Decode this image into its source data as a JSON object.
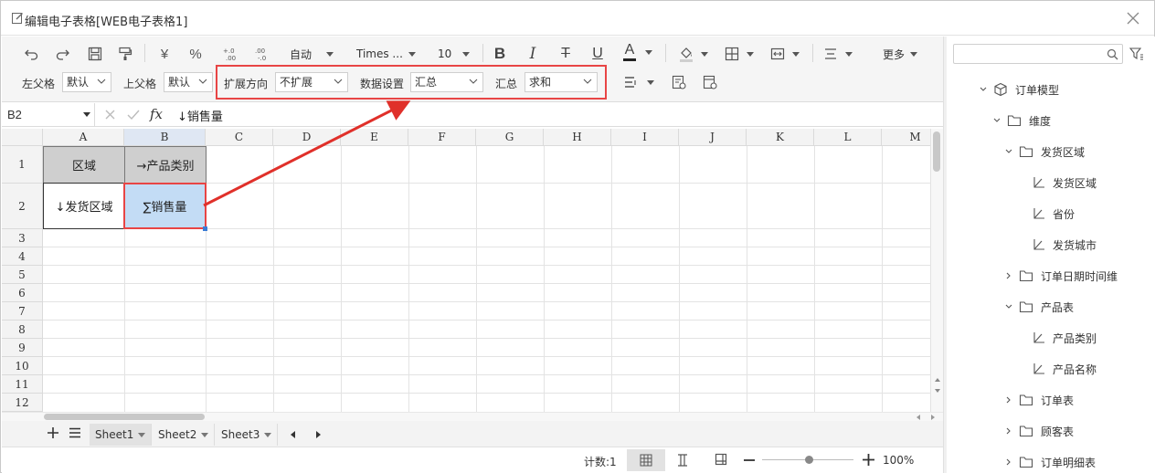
{
  "window": {
    "title": "编辑电子表格[WEB电子表格1]"
  },
  "toolbar": {
    "auto_label": "自动",
    "font_family": "Times ...",
    "font_size": "10",
    "more_label": "更多",
    "left_parent_label": "左父格",
    "left_parent_value": "默认",
    "top_parent_label": "上父格",
    "top_parent_value": "默认",
    "expand_direction_label": "扩展方向",
    "expand_direction_value": "不扩展",
    "data_setting_label": "数据设置",
    "data_setting_value": "汇总",
    "aggregate_label": "汇总",
    "aggregate_value": "求和",
    "currency_symbol": "¥",
    "percent_symbol": "%",
    "bold": "B",
    "italic": "I",
    "strike": "T",
    "underline": "U",
    "font_color": "A"
  },
  "formula_bar": {
    "cell_ref": "B2",
    "fx": "fx",
    "content": "↓销售量"
  },
  "grid": {
    "columns": [
      "A",
      "B",
      "C",
      "D",
      "E",
      "F",
      "G",
      "H",
      "I",
      "J",
      "K",
      "L",
      "M"
    ],
    "rows": [
      "1",
      "2",
      "3",
      "4",
      "5",
      "6",
      "7",
      "8",
      "9",
      "10",
      "11",
      "12"
    ],
    "cells": {
      "A1": "区域",
      "B1": "→产品类别",
      "A2": "↓发货区域",
      "B2": "∑销售量"
    }
  },
  "sheets": {
    "tabs": [
      "Sheet1",
      "Sheet2",
      "Sheet3"
    ],
    "active": "Sheet1"
  },
  "status": {
    "count": "计数:1",
    "zoom": "100%"
  },
  "tree": {
    "root": "订单模型",
    "items": [
      {
        "label": "维度",
        "type": "folder",
        "expanded": true
      },
      {
        "label": "发货区域",
        "type": "folder",
        "expanded": true
      },
      {
        "label": "发货区域",
        "type": "field"
      },
      {
        "label": "省份",
        "type": "field"
      },
      {
        "label": "发货城市",
        "type": "field"
      },
      {
        "label": "订单日期时间维",
        "type": "folder",
        "expanded": false
      },
      {
        "label": "产品表",
        "type": "folder",
        "expanded": true
      },
      {
        "label": "产品类别",
        "type": "field"
      },
      {
        "label": "产品名称",
        "type": "field"
      },
      {
        "label": "订单表",
        "type": "folder",
        "expanded": false
      },
      {
        "label": "顾客表",
        "type": "folder",
        "expanded": false
      },
      {
        "label": "订单明细表",
        "type": "folder",
        "expanded": false
      }
    ]
  },
  "colors": {
    "accent_red": "#e84545",
    "selected_cell": "#c3dcf5",
    "header_gray": "#cfcfcf",
    "arrow_red": "#e0302a"
  }
}
